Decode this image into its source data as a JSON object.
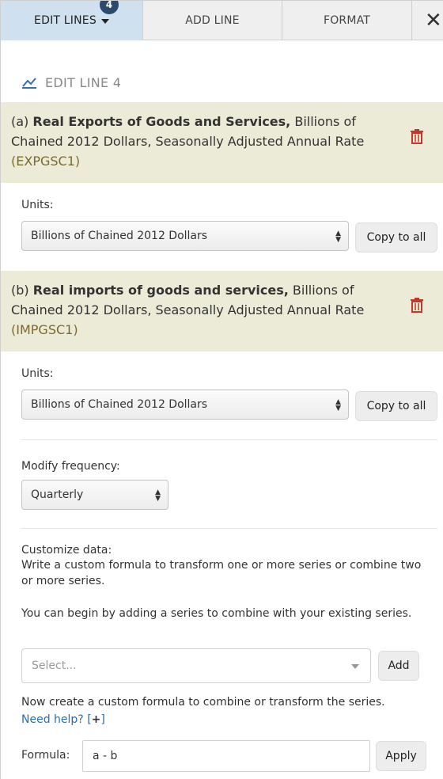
{
  "tabs": [
    {
      "label": "EDIT LINES",
      "badge": "4",
      "active": true
    },
    {
      "label": "ADD LINE"
    },
    {
      "label": "FORMAT"
    }
  ],
  "close_symbol": "✕",
  "edit_heading": "EDIT LINE 4",
  "series": [
    {
      "prefix": "(a)",
      "title": "Real Exports of Goods and Services,",
      "description": "Billions of Chained 2012 Dollars, Seasonally Adjusted Annual Rate",
      "id": "(EXPGSC1)",
      "units_label": "Units:",
      "units_value": "Billions of Chained 2012 Dollars",
      "copy_label": "Copy to all"
    },
    {
      "prefix": "(b)",
      "title": "Real imports of goods and services,",
      "description": "Billions of Chained 2012 Dollars, Seasonally Adjusted Annual Rate",
      "id": "(IMPGSC1)",
      "units_label": "Units:",
      "units_value": "Billions of Chained 2012 Dollars",
      "copy_label": "Copy to all"
    }
  ],
  "frequency": {
    "label": "Modify frequency:",
    "value": "Quarterly"
  },
  "customize": {
    "title": "Customize data:",
    "description": "Write a custom formula to transform one or more series or combine two or more series.",
    "begin_text": "You can begin by adding a series to combine with your existing series.",
    "select_placeholder": "Select...",
    "add_label": "Add",
    "formula_text": "Now create a custom formula to combine or transform the series.",
    "help_link": "Need help?",
    "help_bracket_open": "[",
    "help_plus": "+",
    "help_bracket_close": "]",
    "formula_label": "Formula:",
    "formula_value": "a - b",
    "apply_label": "Apply"
  },
  "colors": {
    "active_tab": "#cfe0ee",
    "series_bg": "#ecebd8",
    "trash": "#c0392b",
    "link": "#2a6fad"
  }
}
